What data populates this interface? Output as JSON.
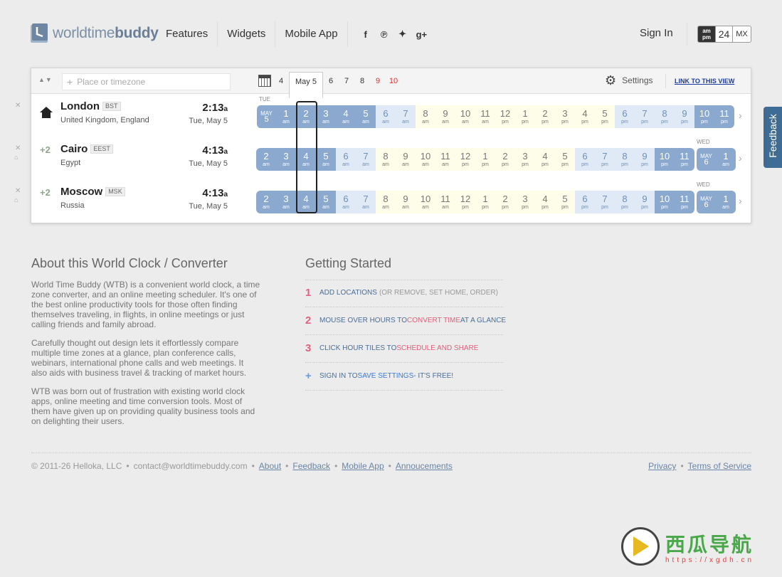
{
  "header": {
    "logo_pre": "worldtime",
    "logo_bold": "buddy",
    "nav": [
      "Features",
      "Widgets",
      "Mobile App"
    ],
    "social": [
      {
        "icon": "facebook-icon",
        "glyph": "f"
      },
      {
        "icon": "pinterest-icon",
        "glyph": "℗"
      },
      {
        "icon": "twitter-icon",
        "glyph": "✦"
      },
      {
        "icon": "google-plus-icon",
        "glyph": "g+"
      }
    ],
    "signin": "Sign In",
    "format": {
      "ampm_top": "am",
      "ampm_bottom": "pm",
      "h24": "24",
      "mx": "MX"
    }
  },
  "toolbar": {
    "search_placeholder": "Place or timezone",
    "days": [
      {
        "label": "4",
        "weekend": false,
        "selected": false
      },
      {
        "label": "May 5",
        "weekend": false,
        "selected": true
      },
      {
        "label": "6",
        "weekend": false,
        "selected": false
      },
      {
        "label": "7",
        "weekend": false,
        "selected": false
      },
      {
        "label": "8",
        "weekend": false,
        "selected": false
      },
      {
        "label": "9",
        "weekend": true,
        "selected": false
      },
      {
        "label": "10",
        "weekend": true,
        "selected": false
      }
    ],
    "settings": "Settings",
    "link_view": "LINK TO THIS VIEW"
  },
  "rows": [
    {
      "offset": "",
      "home": true,
      "city": "London",
      "tz": "BST",
      "country": "United Kingdom, England",
      "time": "2:13",
      "suffix": "a",
      "date": "Tue, May 5",
      "dayname_left": "TUE",
      "dayname_right": "",
      "month_left": {
        "m": "MAY",
        "d": "5"
      },
      "hours": [
        {
          "n": "1",
          "p": "am",
          "t": "night"
        },
        {
          "n": "2",
          "p": "am",
          "t": "night"
        },
        {
          "n": "3",
          "p": "am",
          "t": "night"
        },
        {
          "n": "4",
          "p": "am",
          "t": "night"
        },
        {
          "n": "5",
          "p": "am",
          "t": "night"
        },
        {
          "n": "6",
          "p": "am",
          "t": "dawn"
        },
        {
          "n": "7",
          "p": "am",
          "t": "dawn"
        },
        {
          "n": "8",
          "p": "am",
          "t": "day"
        },
        {
          "n": "9",
          "p": "am",
          "t": "day"
        },
        {
          "n": "10",
          "p": "am",
          "t": "day"
        },
        {
          "n": "11",
          "p": "am",
          "t": "day"
        },
        {
          "n": "12",
          "p": "pm",
          "t": "day"
        },
        {
          "n": "1",
          "p": "pm",
          "t": "day"
        },
        {
          "n": "2",
          "p": "pm",
          "t": "day"
        },
        {
          "n": "3",
          "p": "pm",
          "t": "day"
        },
        {
          "n": "4",
          "p": "pm",
          "t": "day"
        },
        {
          "n": "5",
          "p": "pm",
          "t": "day"
        },
        {
          "n": "6",
          "p": "pm",
          "t": "dawn"
        },
        {
          "n": "7",
          "p": "pm",
          "t": "dawn"
        },
        {
          "n": "8",
          "p": "pm",
          "t": "dawn"
        },
        {
          "n": "9",
          "p": "pm",
          "t": "dawn"
        },
        {
          "n": "10",
          "p": "pm",
          "t": "night"
        },
        {
          "n": "11",
          "p": "pm",
          "t": "night"
        }
      ]
    },
    {
      "offset": "+2",
      "home": false,
      "city": "Cairo",
      "tz": "EEST",
      "country": "Egypt",
      "time": "4:13",
      "suffix": "a",
      "date": "Tue, May 5",
      "dayname_left": "",
      "dayname_right": "WED",
      "month_right": {
        "m": "MAY",
        "d": "6"
      },
      "hours": [
        {
          "n": "2",
          "p": "am",
          "t": "night"
        },
        {
          "n": "3",
          "p": "am",
          "t": "night"
        },
        {
          "n": "4",
          "p": "am",
          "t": "night"
        },
        {
          "n": "5",
          "p": "am",
          "t": "night"
        },
        {
          "n": "6",
          "p": "am",
          "t": "dawn"
        },
        {
          "n": "7",
          "p": "am",
          "t": "dawn"
        },
        {
          "n": "8",
          "p": "am",
          "t": "day"
        },
        {
          "n": "9",
          "p": "am",
          "t": "day"
        },
        {
          "n": "10",
          "p": "am",
          "t": "day"
        },
        {
          "n": "11",
          "p": "am",
          "t": "day"
        },
        {
          "n": "12",
          "p": "pm",
          "t": "day"
        },
        {
          "n": "1",
          "p": "pm",
          "t": "day"
        },
        {
          "n": "2",
          "p": "pm",
          "t": "day"
        },
        {
          "n": "3",
          "p": "pm",
          "t": "day"
        },
        {
          "n": "4",
          "p": "pm",
          "t": "day"
        },
        {
          "n": "5",
          "p": "pm",
          "t": "day"
        },
        {
          "n": "6",
          "p": "pm",
          "t": "dawn"
        },
        {
          "n": "7",
          "p": "pm",
          "t": "dawn"
        },
        {
          "n": "8",
          "p": "pm",
          "t": "dawn"
        },
        {
          "n": "9",
          "p": "pm",
          "t": "dawn"
        },
        {
          "n": "10",
          "p": "pm",
          "t": "night"
        },
        {
          "n": "11",
          "p": "pm",
          "t": "night"
        }
      ],
      "after": [
        {
          "n": "1",
          "p": "am",
          "t": "night"
        }
      ]
    },
    {
      "offset": "+2",
      "home": false,
      "city": "Moscow",
      "tz": "MSK",
      "country": "Russia",
      "time": "4:13",
      "suffix": "a",
      "date": "Tue, May 5",
      "dayname_left": "",
      "dayname_right": "WED",
      "month_right": {
        "m": "MAY",
        "d": "6"
      },
      "hours": [
        {
          "n": "2",
          "p": "am",
          "t": "night"
        },
        {
          "n": "3",
          "p": "am",
          "t": "night"
        },
        {
          "n": "4",
          "p": "am",
          "t": "night"
        },
        {
          "n": "5",
          "p": "am",
          "t": "night"
        },
        {
          "n": "6",
          "p": "am",
          "t": "dawn"
        },
        {
          "n": "7",
          "p": "am",
          "t": "dawn"
        },
        {
          "n": "8",
          "p": "am",
          "t": "day"
        },
        {
          "n": "9",
          "p": "am",
          "t": "day"
        },
        {
          "n": "10",
          "p": "am",
          "t": "day"
        },
        {
          "n": "11",
          "p": "am",
          "t": "day"
        },
        {
          "n": "12",
          "p": "pm",
          "t": "day"
        },
        {
          "n": "1",
          "p": "pm",
          "t": "day"
        },
        {
          "n": "2",
          "p": "pm",
          "t": "day"
        },
        {
          "n": "3",
          "p": "pm",
          "t": "day"
        },
        {
          "n": "4",
          "p": "pm",
          "t": "day"
        },
        {
          "n": "5",
          "p": "pm",
          "t": "day"
        },
        {
          "n": "6",
          "p": "pm",
          "t": "dawn"
        },
        {
          "n": "7",
          "p": "pm",
          "t": "dawn"
        },
        {
          "n": "8",
          "p": "pm",
          "t": "dawn"
        },
        {
          "n": "9",
          "p": "pm",
          "t": "dawn"
        },
        {
          "n": "10",
          "p": "pm",
          "t": "night"
        },
        {
          "n": "11",
          "p": "pm",
          "t": "night"
        }
      ],
      "after": [
        {
          "n": "1",
          "p": "am",
          "t": "night"
        }
      ]
    }
  ],
  "feedback": "Feedback",
  "about": {
    "title": "About this World Clock / Converter",
    "p1": "World Time Buddy (WTB) is a convenient world clock, a time zone converter, and an online meeting scheduler. It's one of the best online productivity tools for those often finding themselves traveling, in flights, in online meetings or just calling friends and family abroad.",
    "p2": "Carefully thought out design lets it effortlessly compare multiple time zones at a glance, plan conference calls, webinars, international phone calls and web meetings. It also aids with business travel & tracking of market hours.",
    "p3": "WTB was born out of frustration with existing world clock apps, online meeting and time conversion tools. Most of them have given up on providing quality business tools and on delighting their users."
  },
  "getting_started": {
    "title": "Getting Started",
    "items": [
      {
        "num": "1",
        "a": "ADD LOCATIONS",
        "b": "(OR REMOVE, SET HOME, ORDER)",
        "c": "",
        "d": ""
      },
      {
        "num": "2",
        "a": "MOUSE OVER HOURS TO ",
        "b": "",
        "c": "CONVERT TIME",
        "d": " AT A GLANCE"
      },
      {
        "num": "3",
        "a": "CLICK HOUR TILES TO ",
        "b": "",
        "c": "SCHEDULE AND SHARE",
        "d": ""
      },
      {
        "num": "+",
        "a": "SIGN IN TO ",
        "b": "",
        "c": "SAVE SETTINGS",
        "d": " - IT'S FREE!"
      }
    ]
  },
  "footer": {
    "copyright": "© 2011-26 Helloka, LLC",
    "contact": "contact@worldtimebuddy.com",
    "links": [
      "About",
      "Feedback",
      "Mobile App",
      "Annoucements"
    ],
    "right_links": [
      "Privacy",
      "Terms of Service"
    ]
  },
  "watermark": {
    "cn": "西瓜导航",
    "url": "https://xgdh.cn"
  }
}
